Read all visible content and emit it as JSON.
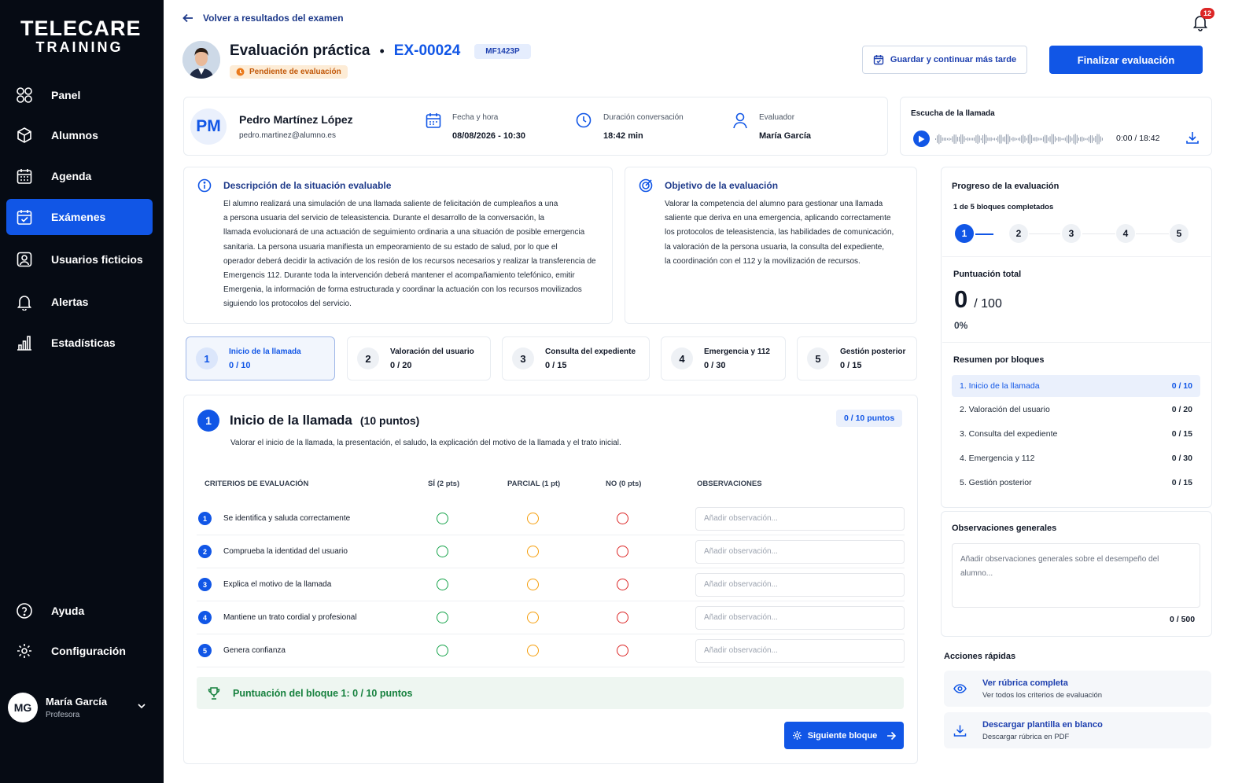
{
  "sidebar": {
    "logo_line1": "TELECARE",
    "logo_line2": "TRAINING",
    "items": [
      {
        "label": "Panel",
        "icon": "grid-icon"
      },
      {
        "label": "Alumnos",
        "icon": "cube-icon"
      },
      {
        "label": "Agenda",
        "icon": "calendar-icon"
      },
      {
        "label": "Exámenes",
        "icon": "calendar-check-icon",
        "active": true
      },
      {
        "label": "Usuarios ficticios",
        "icon": "user-badge-icon"
      },
      {
        "label": "Alertas",
        "icon": "bell-icon"
      },
      {
        "label": "Estadísticas",
        "icon": "bar-chart-icon"
      }
    ],
    "bottom": [
      {
        "label": "Ayuda",
        "icon": "help-icon"
      },
      {
        "label": "Configuración",
        "icon": "gear-icon"
      }
    ],
    "user": {
      "initials": "MG",
      "name": "María García",
      "role": "Profesora"
    }
  },
  "header": {
    "back_label": "Volver a resultados del examen",
    "notifications": "12",
    "title": "Evaluación práctica",
    "exam_code": "EX-00024",
    "module_tag": "MF1423P",
    "status": "Pendiente de evaluación",
    "save_label": "Guardar y continuar más tarde",
    "finish_label": "Finalizar evaluación"
  },
  "student": {
    "initials": "PM",
    "name": "Pedro Martínez López",
    "email": "pedro.martinez@alumno.es",
    "date_label": "Fecha y hora",
    "date_value": "08/08/2026 - 10:30",
    "duration_label": "Duración conversación",
    "duration_value": "18:42 min",
    "evaluator_label": "Evaluador",
    "evaluator_value": "María García"
  },
  "audio": {
    "title": "Escucha de la llamada",
    "time": "0:00 / 18:42"
  },
  "description": {
    "title": "Descripción de la situación evaluable",
    "lines": [
      "El alumno realizará una simulación de una llamada saliente de felicitación de cumpleaños a una",
      "a persona usuaria del servicio de teleasistencia. Durante el desarrollo de la conversación, la",
      "llamada evolucionará de una actuación de seguimiento ordinaria a una situación de posible emergencia",
      "sanitaria. La persona usuaria manifiesta un empeoramiento de su estado de salud, por lo que el",
      "operador deberá decidir la activación de los resión de los recursos necesarios y realizar la transferencia de",
      "Emergencis 112. Durante toda la intervención deberá mantener el acompañamiento telefónico, emitir",
      "Emergenia, la información de forma estructurada y coordinar la actuación con los recursos movilizados",
      "siguiendo los protocolos del servicio."
    ]
  },
  "objective": {
    "title": "Objetivo de la evaluación",
    "lines": [
      "Valorar la competencia del alumno para gestionar una llamada",
      "saliente que deriva en una emergencia, aplicando correctamente",
      "los protocolos de teleasistencia, las habilidades de comunicación,",
      "la valoración de la persona usuaria, la consulta del expediente,",
      "la coordinación con el 112 y la movilización de recursos."
    ]
  },
  "blocks": [
    {
      "n": "1",
      "label": "Inicio de la llamada",
      "score": "0 / 10"
    },
    {
      "n": "2",
      "label": "Valoración del usuario",
      "score": "0 / 20"
    },
    {
      "n": "3",
      "label": "Consulta del expediente",
      "score": "0 / 15"
    },
    {
      "n": "4",
      "label": "Emergencia y 112",
      "score": "0 / 30"
    },
    {
      "n": "5",
      "label": "Gestión posterior",
      "score": "0 / 15"
    }
  ],
  "current_block": {
    "n": "1",
    "title": "Inicio de la llamada",
    "points": "(10 puntos)",
    "badge": "0 / 10 puntos",
    "description": "Valorar el inicio de la llamada, la presentación, el saludo, la explicación del motivo de la llamada y el trato inicial.",
    "headers": {
      "criteria": "CRITERIOS DE EVALUACIÓN",
      "yes": "SÍ (2 pts)",
      "partial": "PARCIAL (1 pt)",
      "no": "NO (0 pts)",
      "obs": "OBSERVACIONES"
    },
    "criteria": [
      {
        "n": "1",
        "text": "Se identifica y saluda correctamente"
      },
      {
        "n": "2",
        "text": "Comprueba la identidad del usuario"
      },
      {
        "n": "3",
        "text": "Explica el motivo de la llamada"
      },
      {
        "n": "4",
        "text": "Mantiene un trato cordial y profesional"
      },
      {
        "n": "5",
        "text": "Genera confianza"
      }
    ],
    "obs_placeholder": "Añadir observación...",
    "score_label": "Puntuación del bloque 1: 0 / 10 puntos",
    "next_label": "Siguiente bloque"
  },
  "progress": {
    "title": "Progreso de la evaluación",
    "subtitle": "1 de 5 bloques completados",
    "steps": [
      "1",
      "2",
      "3",
      "4",
      "5"
    ],
    "total_label": "Puntuación total",
    "total_value": "0",
    "total_max": "/ 100",
    "percent": "0%"
  },
  "summary": {
    "title": "Resumen por bloques",
    "rows": [
      {
        "label": "1. Inicio de la llamada",
        "score": "0 / 10"
      },
      {
        "label": "2. Valoración del usuario",
        "score": "0 / 20"
      },
      {
        "label": "3. Consulta del expediente",
        "score": "0 / 15"
      },
      {
        "label": "4. Emergencia y 112",
        "score": "0 / 30"
      },
      {
        "label": "5. Gestión posterior",
        "score": "0 / 15"
      }
    ]
  },
  "general_obs": {
    "title": "Observaciones generales",
    "placeholder": "Añadir observaciones generales sobre el desempeño del alumno...",
    "counter": "0 / 500"
  },
  "quick_actions": {
    "title": "Acciones rápidas",
    "items": [
      {
        "title": "Ver rúbrica completa",
        "subtitle": "Ver todos los criterios de evaluación"
      },
      {
        "title": "Descargar plantilla en blanco",
        "subtitle": "Descargar rúbrica en PDF"
      }
    ]
  },
  "colors": {
    "primary": "#1156e6",
    "sidebar": "#060b14",
    "yes": "#16a34a",
    "partial": "#f59e0b",
    "no": "#dc2626"
  }
}
